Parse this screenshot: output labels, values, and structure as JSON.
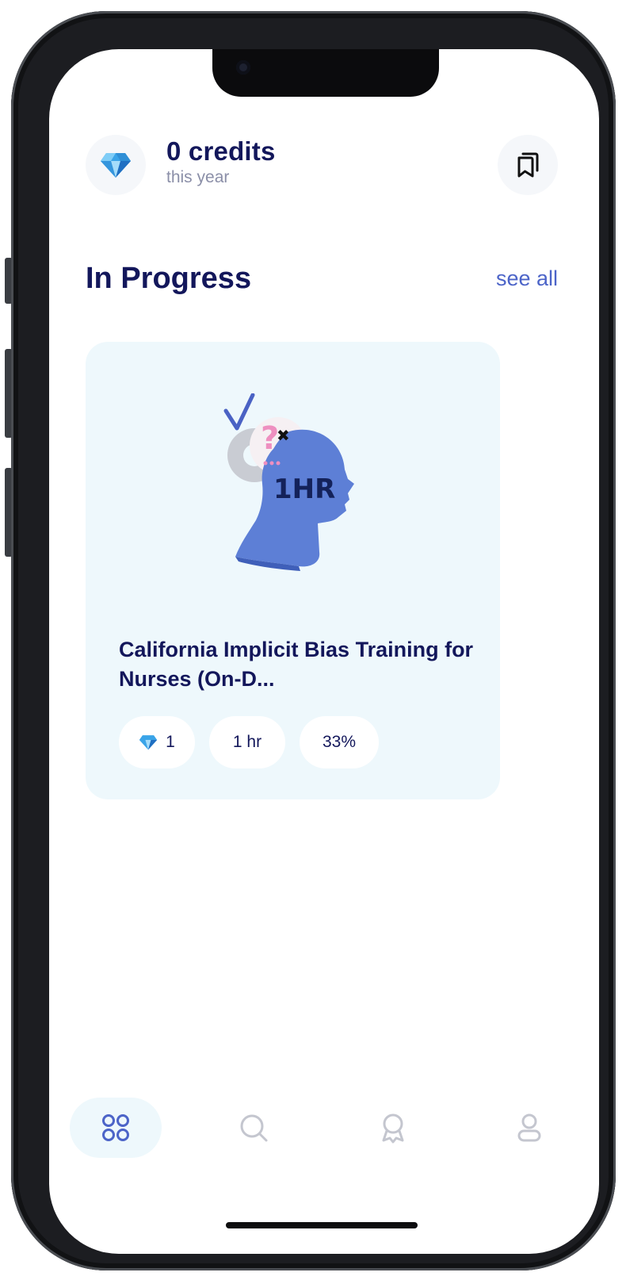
{
  "header": {
    "credits_label": "0 credits",
    "credits_sub": "this year",
    "gem_icon": "diamond-icon",
    "bookmarks_icon": "bookmarks-icon"
  },
  "section": {
    "title": "In Progress",
    "see_all_label": "see all"
  },
  "course": {
    "title": "California Implicit Bias Training for Nurses (On-D...",
    "art_text": "1HR",
    "credits": "1",
    "duration": "1 hr",
    "progress": "33%",
    "progress_value": 0.33
  },
  "nav": {
    "items": [
      {
        "name": "home",
        "icon": "grid-icon",
        "active": true
      },
      {
        "name": "search",
        "icon": "search-icon",
        "active": false
      },
      {
        "name": "achievements",
        "icon": "award-icon",
        "active": false
      },
      {
        "name": "profile",
        "icon": "user-icon",
        "active": false
      }
    ]
  },
  "colors": {
    "primary_text": "#13175b",
    "accent": "#4c64c8",
    "card_bg": "#eef8fc",
    "gem": "#3aa4e8"
  }
}
